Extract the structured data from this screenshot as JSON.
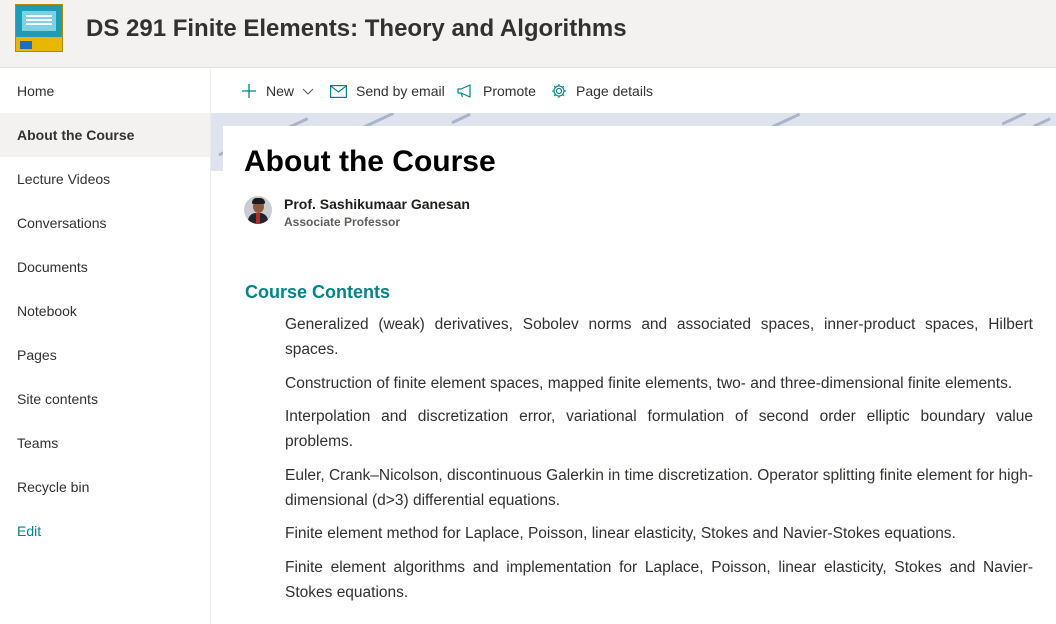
{
  "site": {
    "title": "DS 291 Finite Elements: Theory and Algorithms",
    "logo_icon": "book-cover-icon"
  },
  "nav": {
    "items": [
      {
        "label": "Home"
      },
      {
        "label": "About the Course",
        "active": true
      },
      {
        "label": "Lecture Videos"
      },
      {
        "label": "Conversations"
      },
      {
        "label": "Documents"
      },
      {
        "label": "Notebook"
      },
      {
        "label": "Pages"
      },
      {
        "label": "Site contents"
      },
      {
        "label": "Teams"
      },
      {
        "label": "Recycle bin"
      }
    ],
    "edit_label": "Edit"
  },
  "commandbar": {
    "new_label": "New",
    "send_email_label": "Send by email",
    "promote_label": "Promote",
    "page_details_label": "Page details"
  },
  "page": {
    "title": "About the Course",
    "author": {
      "name": "Prof. Sashikumaar Ganesan",
      "role": "Associate Professor"
    },
    "section_heading": "Course Contents",
    "contents": [
      "Generalized (weak) derivatives, Sobolev norms and associated spaces, inner-product spaces, Hilbert spaces.",
      "Construction of finite element spaces, mapped finite elements, two- and three-dimensional finite elements.",
      "Interpolation and discretization error, variational formulation of second order elliptic boundary value problems.",
      "Euler, Crank–Nicolson, discontinuous Galerkin in time discretization. Operator splitting finite element for high-dimensional (d>3) differential equations.",
      "Finite element method for Laplace, Poisson, linear elasticity, Stokes and Navier-Stokes equations.",
      "Finite element algorithms and implementation for Laplace, Poisson, linear elasticity, Stokes and Navier-Stokes equations."
    ]
  },
  "colors": {
    "accent": "#038387",
    "header_bg": "#f3f2f1",
    "active_nav_bg": "#f3f2f1"
  }
}
